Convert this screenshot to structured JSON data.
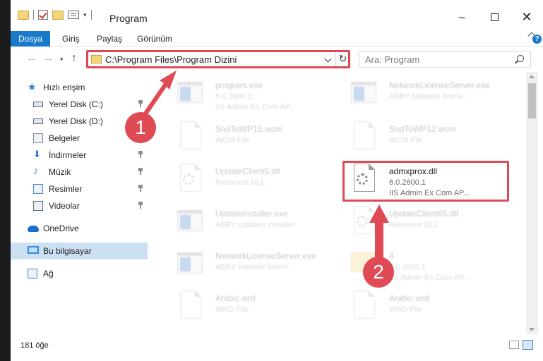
{
  "window": {
    "title": "Program",
    "minimize_glyph": "–",
    "close_glyph": "✕"
  },
  "ribbon": {
    "tabs": [
      "Dosya",
      "Giriş",
      "Paylaş",
      "Görünüm"
    ]
  },
  "nav": {
    "back_glyph": "←",
    "forward_glyph": "→",
    "recent_glyph": "▾",
    "up_glyph": "↑",
    "address_path": "C:\\Program Files\\Program Dizini",
    "refresh_glyph": "↻",
    "search_placeholder": "Ara: Program"
  },
  "sidebar": {
    "items": [
      {
        "label": "Hızlı erişim",
        "icon": "star-icon"
      },
      {
        "label": "Yerel Disk (C:)",
        "icon": "drive-icon",
        "pinned": true
      },
      {
        "label": "Yerel Disk (D:)",
        "icon": "drive-icon",
        "pinned": true
      },
      {
        "label": "Belgeler",
        "icon": "documents-icon"
      },
      {
        "label": "İndirmeler",
        "icon": "downloads-icon",
        "pinned": true
      },
      {
        "label": "Müzik",
        "icon": "music-icon",
        "pinned": true
      },
      {
        "label": "Resimler",
        "icon": "pictures-icon",
        "pinned": true
      },
      {
        "label": "Videolar",
        "icon": "videos-icon",
        "pinned": true
      },
      {
        "label": "OneDrive",
        "icon": "cloud-icon"
      },
      {
        "label": "Bu bilgisayar",
        "icon": "computer-icon",
        "selected": true
      },
      {
        "label": "Ağ",
        "icon": "network-icon"
      }
    ]
  },
  "files": [
    {
      "name": "program.exe",
      "line2": "6.0.2600.1",
      "line3": "IIS Admin Ex Com AP...",
      "icon": "app-icon"
    },
    {
      "name": "NetworkLicenseServer.exe",
      "line2": "ABBY Network licens...",
      "line3": "",
      "icon": "app-icon"
    },
    {
      "name": "SndToWP15.wcm",
      "line2": "WCM File",
      "line3": "",
      "icon": "document-icon"
    },
    {
      "name": "SndToWP12.wcm",
      "line2": "WCM File",
      "line3": "",
      "icon": "document-icon"
    },
    {
      "name": "UpdateClient5.dll",
      "line2": "Resource DLL",
      "line3": "",
      "icon": "dll-icon"
    },
    {
      "name": "admxprox.dll",
      "line2": "6.0.2600.1",
      "line3": "IIS Admin Ex Com AP...",
      "icon": "dll-icon"
    },
    {
      "name": "UpdateInstaller.exe",
      "line2": "ABBY updates installer",
      "line3": "",
      "icon": "app-icon"
    },
    {
      "name": "UpdateClient65.dll",
      "line2": "Resource DLL",
      "line3": "",
      "icon": "dll-icon"
    },
    {
      "name": "NetworkLicenseServer.exe",
      "line2": "ABBY network licens...",
      "line3": "",
      "icon": "app-icon"
    },
    {
      "name": "4",
      "line2": "6.0.2600.1",
      "line3": "IIS Admin Ex Com AP...",
      "icon": "folder-icon"
    },
    {
      "name": "Arabic.wrd",
      "line2": "WRD File",
      "line3": "",
      "icon": "document-icon"
    },
    {
      "name": "Arabic.wrd",
      "line2": "WRD File",
      "line3": "",
      "icon": "document-icon"
    }
  ],
  "status": {
    "item_count": "181 öğe"
  },
  "annotations": {
    "step1": "1",
    "step2": "2",
    "color": "#e04a55"
  }
}
